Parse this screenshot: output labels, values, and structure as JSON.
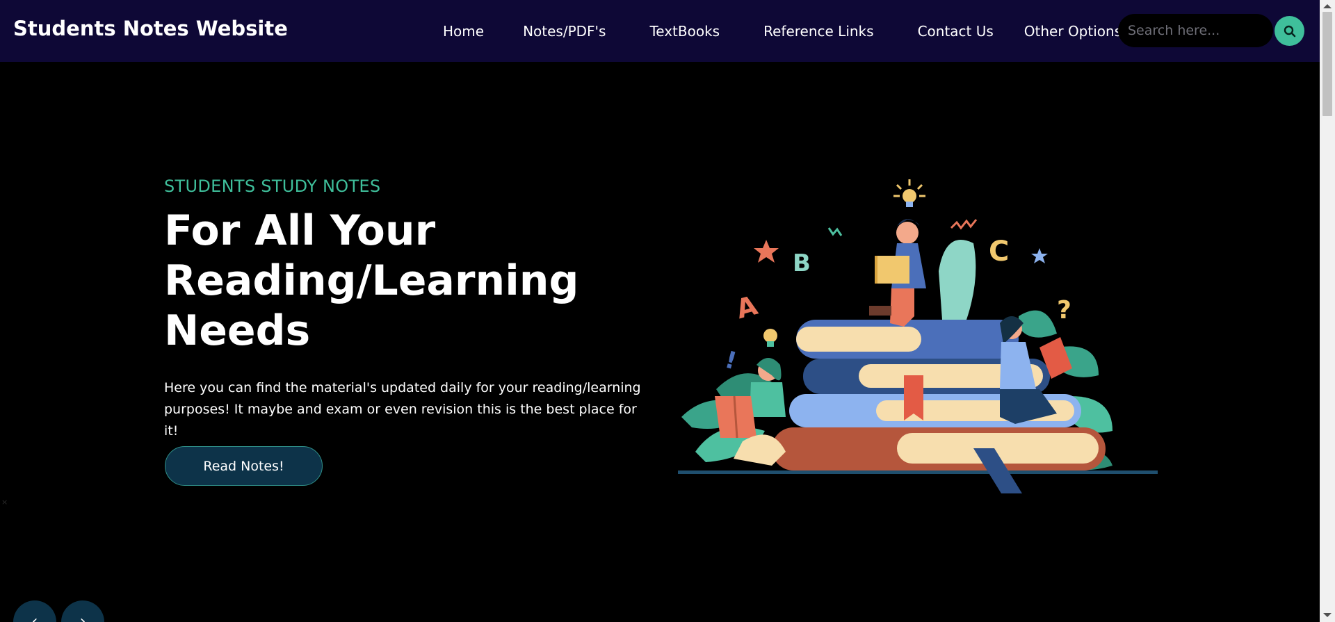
{
  "header": {
    "brand": "Students Notes Website",
    "nav": [
      "Home",
      "Notes/PDF's",
      "TextBooks",
      "Reference Links",
      "Contact Us",
      "Other Options ▼"
    ],
    "search_placeholder": "Search here..."
  },
  "hero": {
    "eyebrow": "STUDENTS STUDY NOTES",
    "headline_line1": "For All Your",
    "headline_line2": "Reading/Learning",
    "headline_line3": "Needs",
    "description": "Here you can find the material's updated daily for your reading/learning purposes! It maybe and exam or even revision this is the best place for it!",
    "cta_label": "Read Notes!"
  },
  "illustration_letters": [
    "A",
    "B",
    "C",
    "!",
    "?"
  ],
  "colors": {
    "nav_bg": "#0e0836",
    "accent": "#3fbf9b",
    "button_bg": "#0d3349",
    "page_bg": "#000000"
  },
  "icons": {
    "search": "search-icon",
    "prev": "chevron-left-icon",
    "next": "chevron-right-icon"
  }
}
